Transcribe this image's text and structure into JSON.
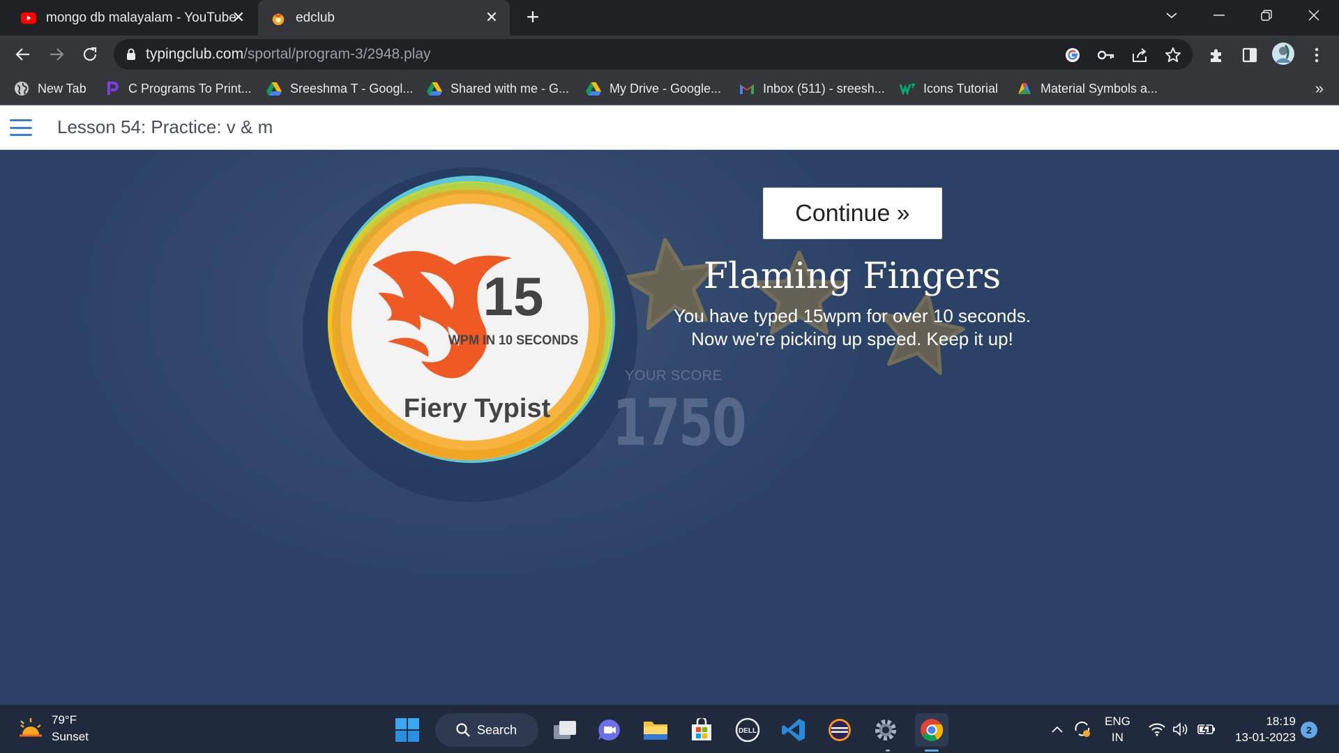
{
  "tabs": [
    {
      "title": "mongo db malayalam - YouTube",
      "icon": "youtube-icon",
      "active": false
    },
    {
      "title": "edclub",
      "icon": "edclub-icon",
      "active": true
    }
  ],
  "address": {
    "host": "typingclub.com",
    "path": "/sportal/program-3/2948.play"
  },
  "bookmarks": [
    {
      "label": "New Tab",
      "icon": "globe-icon"
    },
    {
      "label": "C Programs To Print...",
      "icon": "bookmark-p-icon"
    },
    {
      "label": "Sreeshma T - Googl...",
      "icon": "google-drive-icon"
    },
    {
      "label": "Shared with me - G...",
      "icon": "google-drive-icon"
    },
    {
      "label": "My Drive - Google...",
      "icon": "google-drive-icon"
    },
    {
      "label": "Inbox (511) - sreesh...",
      "icon": "gmail-icon"
    },
    {
      "label": "Icons Tutorial",
      "icon": "w3schools-icon"
    },
    {
      "label": "Material Symbols a...",
      "icon": "material-icon"
    }
  ],
  "header": {
    "lesson_title": "Lesson 54: Practice: v & m"
  },
  "badge": {
    "number": "15",
    "subtitle": "WPM IN 10 SECONDS",
    "name": "Fiery Typist"
  },
  "score": {
    "label": "YOUR SCORE",
    "value": "1750"
  },
  "achievement": {
    "continue_label": "Continue »",
    "title": "Flaming Fingers",
    "line1": "You have typed 15wpm for over 10 seconds.",
    "line2": "Now we're picking up speed. Keep it up!"
  },
  "taskbar": {
    "weather_temp": "79°F",
    "weather_desc": "Sunset",
    "search_label": "Search",
    "lang_top": "ENG",
    "lang_bottom": "IN",
    "time": "18:19",
    "date": "13-01-2023",
    "notifications": "2"
  }
}
